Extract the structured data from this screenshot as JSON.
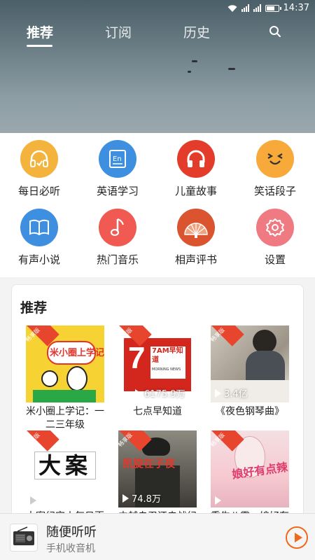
{
  "status": {
    "time": "14:37"
  },
  "tabs": [
    {
      "label": "推荐",
      "active": true
    },
    {
      "label": "订阅",
      "active": false
    },
    {
      "label": "历史",
      "active": false
    }
  ],
  "categories": [
    {
      "label": "每日必听",
      "icon": "headphones-icon",
      "color": "#f3b33d"
    },
    {
      "label": "英语学习",
      "icon": "english-book-icon",
      "color": "#3f8fe0"
    },
    {
      "label": "儿童故事",
      "icon": "headphones-icon",
      "color": "#e43c2a"
    },
    {
      "label": "笑话段子",
      "icon": "smiley-face-icon",
      "color": "#f7a93a"
    },
    {
      "label": "有声小说",
      "icon": "open-book-icon",
      "color": "#3f8fe0"
    },
    {
      "label": "热门音乐",
      "icon": "music-note-icon",
      "color": "#f05a52"
    },
    {
      "label": "相声评书",
      "icon": "fan-icon",
      "color": "#d9542f"
    },
    {
      "label": "设置",
      "icon": "gear-icon",
      "color": "#f07a82"
    }
  ],
  "recommend": {
    "title": "推荐",
    "tag_label": "畅享版",
    "items": [
      {
        "caption": "米小圈上学记：一二三年级",
        "count": "",
        "cover_text": "米小圈上学记"
      },
      {
        "caption": "七点早知道",
        "count": "6175.9万",
        "cover_text": "7AM早知道",
        "cover_sub": "MORNING NEWS"
      },
      {
        "caption": "《夜色钢琴曲》",
        "count": "3.4亿",
        "cover_text": ""
      },
      {
        "caption": "大案纪实丨每日更新",
        "count": "",
        "cover_text": "大案"
      },
      {
        "caption": "中越自卫还击战纪实",
        "count": "74.8万",
        "cover_text": "凯旋在子夜"
      },
      {
        "caption": "重生八零：娘好有点辣",
        "count": "",
        "cover_text": "娘好有点辣"
      }
    ]
  },
  "player": {
    "title": "随便听听",
    "subtitle": "手机收音机"
  }
}
